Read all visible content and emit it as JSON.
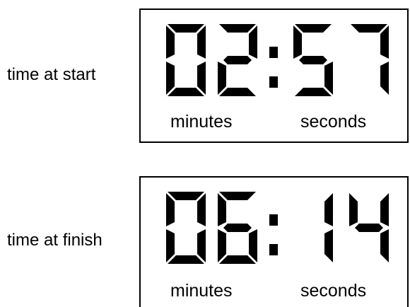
{
  "timers": [
    {
      "label": "time at start",
      "minutes": "02",
      "seconds": "57",
      "separator": ":",
      "minutes_unit": "minutes",
      "seconds_unit": "seconds"
    },
    {
      "label": "time at finish",
      "minutes": "06",
      "seconds": "14",
      "separator": ":",
      "minutes_unit": "minutes",
      "seconds_unit": "seconds"
    }
  ],
  "colors": {
    "digit": "#000000",
    "background": "#ffffff",
    "border": "#000000"
  }
}
